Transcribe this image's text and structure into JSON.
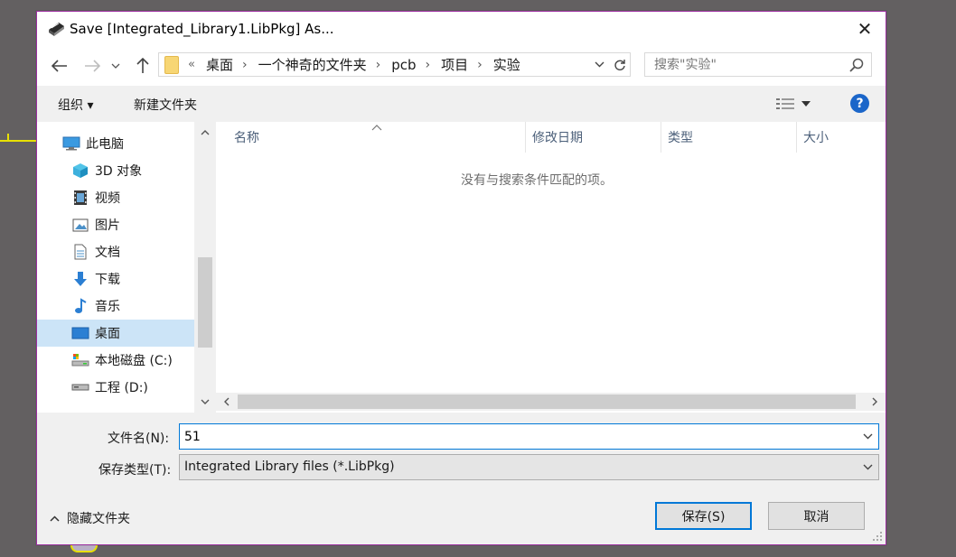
{
  "window": {
    "title": "Save [Integrated_Library1.LibPkg] As...",
    "close_symbol": "✕"
  },
  "address": {
    "overflow": "«",
    "crumbs": [
      "桌面",
      "一个神奇的文件夹",
      "pcb",
      "项目",
      "实验"
    ]
  },
  "search": {
    "placeholder": "搜索\"实验\""
  },
  "toolbar": {
    "organize": "组织 ▾",
    "new_folder": "新建文件夹",
    "help": "?"
  },
  "sidebar": {
    "items": [
      {
        "label": "此电脑",
        "icon": "computer-icon"
      },
      {
        "label": "3D 对象",
        "icon": "3d-objects-icon"
      },
      {
        "label": "视频",
        "icon": "video-icon"
      },
      {
        "label": "图片",
        "icon": "pictures-icon"
      },
      {
        "label": "文档",
        "icon": "documents-icon"
      },
      {
        "label": "下载",
        "icon": "download-icon"
      },
      {
        "label": "音乐",
        "icon": "music-icon"
      },
      {
        "label": "桌面",
        "icon": "desktop-icon",
        "selected": true
      },
      {
        "label": "本地磁盘 (C:)",
        "icon": "local-disk-icon"
      },
      {
        "label": "工程 (D:)",
        "icon": "drive-icon"
      }
    ]
  },
  "file_list": {
    "columns": [
      "名称",
      "修改日期",
      "类型",
      "大小"
    ],
    "empty_message": "没有与搜索条件匹配的项。"
  },
  "form": {
    "filename_label": "文件名(N):",
    "filename_value": "51",
    "filetype_label": "保存类型(T):",
    "filetype_value": "Integrated Library files (*.LibPkg)"
  },
  "footer": {
    "hide_folders": "隐藏文件夹",
    "save_button": "保存(S)",
    "cancel_button": "取消"
  },
  "colors": {
    "accent": "#0078d7",
    "selected_row": "#cce4f7",
    "window_border": "#9c2fa0"
  }
}
